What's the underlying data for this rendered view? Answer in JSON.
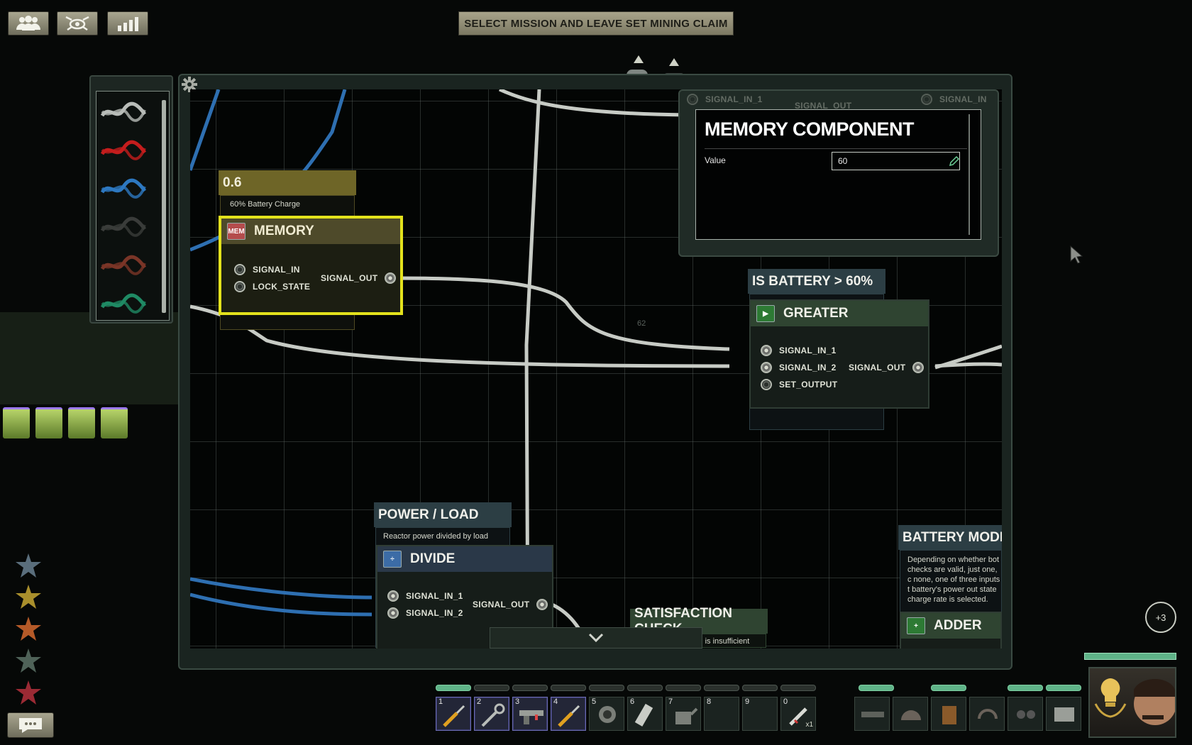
{
  "top_bar": {
    "mission_text": "SELECT MISSION AND LEAVE SET MINING CLAIM",
    "buttons": [
      "crew",
      "command",
      "statistics"
    ]
  },
  "wire_palette": {
    "colors": [
      "#b8bcb8",
      "#c41d1d",
      "#2d78c0",
      "#3a3c3a",
      "#7a3527",
      "#1f8a64"
    ]
  },
  "nodes": {
    "battery_label": {
      "title": "0.6",
      "note": "60% Battery Charge"
    },
    "memory": {
      "title": "MEMORY",
      "icon_text": "MEM",
      "pins_in": [
        "SIGNAL_IN",
        "LOCK_STATE"
      ],
      "pin_out": "SIGNAL_OUT"
    },
    "battery_check_label": {
      "title": "IS BATTERY > 60%"
    },
    "greater": {
      "title": "GREATER",
      "pins_in": [
        "SIGNAL_IN_1",
        "SIGNAL_IN_2",
        "SET_OUTPUT"
      ],
      "pin_out": "SIGNAL_OUT"
    },
    "power_load_label": {
      "title": "POWER / LOAD",
      "note": "Reactor power divided by load"
    },
    "divide": {
      "title": "DIVIDE",
      "pins_in": [
        "SIGNAL_IN_1",
        "SIGNAL_IN_2"
      ],
      "pin_out": "SIGNAL_OUT"
    },
    "satisfaction_label": {
      "title": "SATISFACTION CHECK",
      "note": "atisfaction is insufficient"
    },
    "battery_mode_label": {
      "title": "BATTERY MODE DEC",
      "note": "Depending on whether bot checks are valid, just one, c none, one of three inputs t battery's power out state charge rate is selected."
    },
    "adder": {
      "title": "ADDER"
    },
    "hidden_pins": [
      "SIGNAL_IN_1",
      "SIGNAL_OUT",
      "SIGNAL_IN"
    ]
  },
  "memory_component_window": {
    "title": "MEMORY COMPONENT",
    "value_label": "Value",
    "value": "60"
  },
  "misc": {
    "notification_count": "+3",
    "grid_number": "62"
  },
  "hotbar": {
    "slots": [
      {
        "num": "1",
        "item": "screwdriver-icon",
        "active": true,
        "bar": true
      },
      {
        "num": "2",
        "item": "wrench-icon",
        "active": true,
        "bar": false
      },
      {
        "num": "3",
        "item": "gun-icon",
        "active": true,
        "bar": false
      },
      {
        "num": "4",
        "item": "screwdriver-icon",
        "active": true,
        "bar": false
      },
      {
        "num": "5",
        "item": "diving-mask-icon",
        "active": false,
        "bar": false
      },
      {
        "num": "6",
        "item": "flashlight-icon",
        "active": false,
        "bar": false
      },
      {
        "num": "7",
        "item": "watering-can-icon",
        "active": false,
        "bar": false
      },
      {
        "num": "8",
        "item": "",
        "active": false,
        "bar": false
      },
      {
        "num": "9",
        "item": "",
        "active": false,
        "bar": false
      },
      {
        "num": "0",
        "item": "syringe-icon",
        "active": false,
        "bar": false,
        "count": "x1"
      }
    ],
    "equipment": [
      "gun-icon",
      "helmet-icon",
      "armor-icon",
      "headset-icon",
      "goggles-icon",
      "id-card-icon"
    ]
  },
  "skills": [
    "electrical-skill-icon",
    "mechanical-skill-icon",
    "weapons-skill-icon",
    "helm-skill-icon",
    "medical-skill-icon"
  ]
}
